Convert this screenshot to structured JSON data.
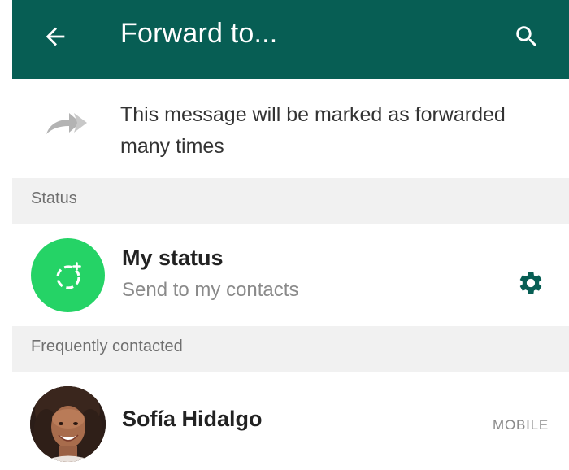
{
  "app_bar": {
    "title": "Forward to...",
    "back_icon": "arrow-left-icon",
    "search_icon": "search-icon",
    "background_color": "#075e54"
  },
  "notice": {
    "icon": "forwarded-many-times-icon",
    "text": "This message will be marked as forwarded many times"
  },
  "sections": {
    "status": {
      "header": "Status",
      "item": {
        "title": "My status",
        "subtitle": "Send to my contacts",
        "avatar_icon": "add-status-icon",
        "avatar_color": "#25d366",
        "settings_icon": "gear-icon",
        "settings_color": "#075e54"
      }
    },
    "frequent": {
      "header": "Frequently contacted",
      "contacts": [
        {
          "name": "Sofía Hidalgo",
          "type": "MOBILE",
          "avatar": "contact-photo"
        }
      ]
    }
  }
}
